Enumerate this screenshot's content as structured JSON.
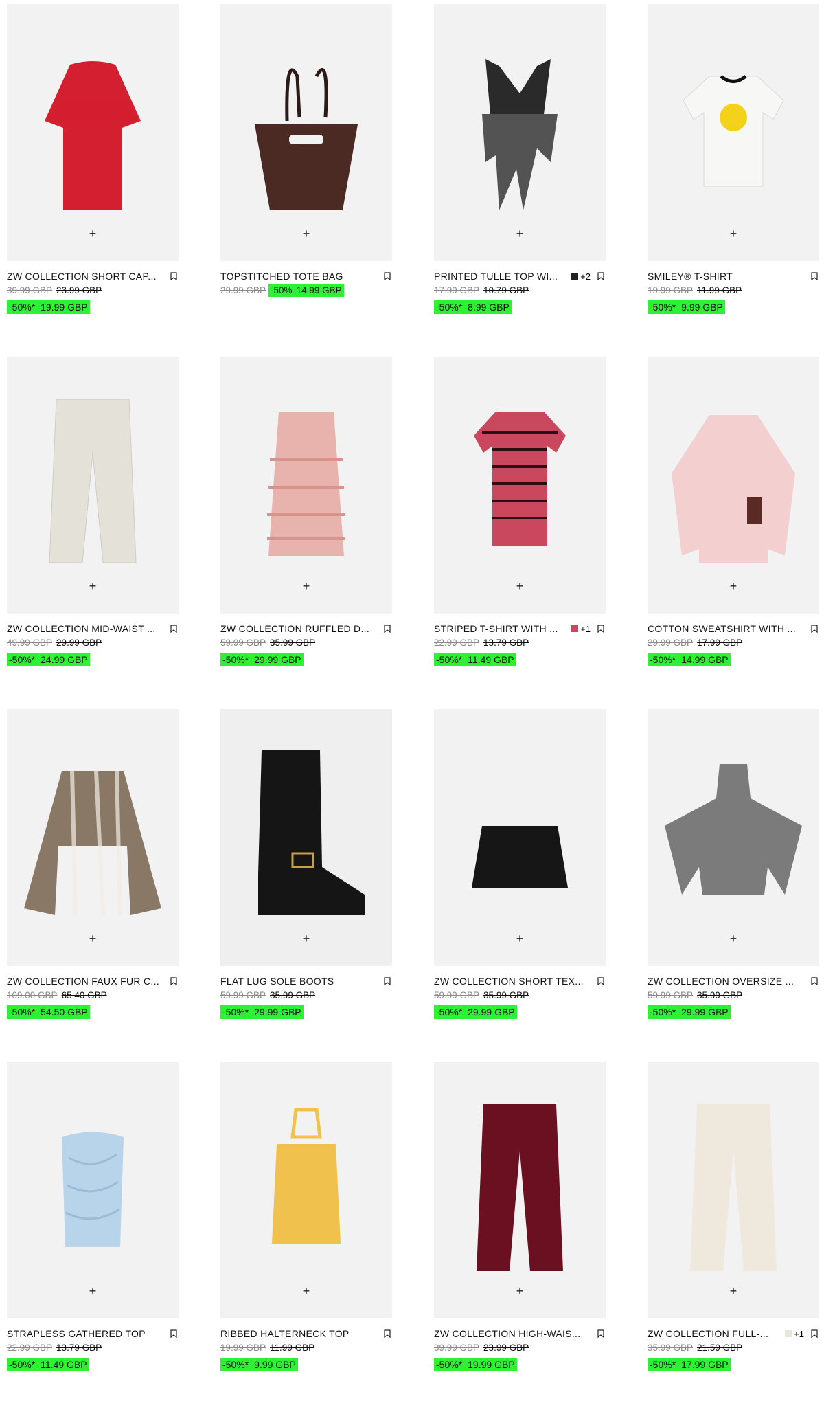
{
  "colors": {
    "sale_highlight": "#2df233",
    "card_bg": "#f2f2f2",
    "old_price": "#8a8a8a"
  },
  "icons": {
    "add": "plus-icon",
    "save": "bookmark-icon"
  },
  "products": [
    {
      "name": "ZW COLLECTION SHORT CAP...",
      "old_price": "39.99 GBP",
      "mid_price": "23.99 GBP",
      "discount": "-50%*",
      "sale_price": "19.99 GBP",
      "art": "dress",
      "color": "#d31f2f"
    },
    {
      "name": "TOPSTITCHED TOTE BAG",
      "old_price": "29.99 GBP",
      "discount": "-50%",
      "sale_price": "14.99 GBP",
      "inline_sale": true,
      "art": "bag",
      "color": "#4a2a22"
    },
    {
      "name": "PRINTED TULLE TOP WI...",
      "old_price": "17.99 GBP",
      "mid_price": "10.79 GBP",
      "discount": "-50%*",
      "sale_price": "8.99 GBP",
      "swatch": "#222222",
      "more": "+2",
      "art": "tulle",
      "color": "#2a2a2a"
    },
    {
      "name": "SMILEY® T-SHIRT",
      "old_price": "19.99 GBP",
      "mid_price": "11.99 GBP",
      "discount": "-50%*",
      "sale_price": "9.99 GBP",
      "art": "tshirt",
      "color": "#f7f7f5"
    },
    {
      "name": "ZW COLLECTION MID-WAIST ...",
      "old_price": "49.99 GBP",
      "mid_price": "29.99 GBP",
      "discount": "-50%*",
      "sale_price": "24.99 GBP",
      "art": "jeans",
      "color": "#e3e1d8"
    },
    {
      "name": "ZW COLLECTION RUFFLED D...",
      "old_price": "59.99 GBP",
      "mid_price": "35.99 GBP",
      "discount": "-50%*",
      "sale_price": "29.99 GBP",
      "art": "ruffle",
      "color": "#e9b3ad"
    },
    {
      "name": "STRIPED T-SHIRT WITH ...",
      "old_price": "22.99 GBP",
      "mid_price": "13.79 GBP",
      "discount": "-50%*",
      "sale_price": "11.49 GBP",
      "swatch": "#c9485e",
      "more": "+1",
      "art": "stripe",
      "color": "#c9485e"
    },
    {
      "name": "COTTON SWEATSHIRT WITH ...",
      "old_price": "29.99 GBP",
      "mid_price": "17.99 GBP",
      "discount": "-50%*",
      "sale_price": "14.99 GBP",
      "art": "sweat",
      "color": "#f3cfd0"
    },
    {
      "name": "ZW COLLECTION FAUX FUR C...",
      "old_price": "109.00 GBP",
      "mid_price": "65.40 GBP",
      "discount": "-50%*",
      "sale_price": "54.50 GBP",
      "art": "fur",
      "color": "#8a7866"
    },
    {
      "name": "FLAT LUG SOLE BOOTS",
      "old_price": "59.99 GBP",
      "mid_price": "35.99 GBP",
      "discount": "-50%*",
      "sale_price": "29.99 GBP",
      "art": "boot",
      "color": "#151515",
      "bg": "#efefef"
    },
    {
      "name": "ZW COLLECTION SHORT TEX...",
      "old_price": "59.99 GBP",
      "mid_price": "35.99 GBP",
      "discount": "-50%*",
      "sale_price": "29.99 GBP",
      "art": "skirt",
      "color": "#161616"
    },
    {
      "name": "ZW COLLECTION OVERSIZE ...",
      "old_price": "59.99 GBP",
      "mid_price": "35.99 GBP",
      "discount": "-50%*",
      "sale_price": "29.99 GBP",
      "art": "poncho",
      "color": "#7b7b7b"
    },
    {
      "name": "STRAPLESS GATHERED TOP",
      "old_price": "22.99 GBP",
      "mid_price": "13.79 GBP",
      "discount": "-50%*",
      "sale_price": "11.49 GBP",
      "art": "tube",
      "color": "#b8d4ea"
    },
    {
      "name": "RIBBED HALTERNECK TOP",
      "old_price": "19.99 GBP",
      "mid_price": "11.99 GBP",
      "discount": "-50%*",
      "sale_price": "9.99 GBP",
      "art": "halter",
      "color": "#f0c24d"
    },
    {
      "name": "ZW COLLECTION HIGH-WAIS...",
      "old_price": "39.99 GBP",
      "mid_price": "23.99 GBP",
      "discount": "-50%*",
      "sale_price": "19.99 GBP",
      "art": "trousers",
      "color": "#6b1020"
    },
    {
      "name": "ZW COLLECTION FULL-...",
      "old_price": "35.99 GBP",
      "mid_price": "21.59 GBP",
      "discount": "-50%*",
      "sale_price": "17.99 GBP",
      "swatch": "#ece6d8",
      "more": "+1",
      "art": "trousers",
      "color": "#eee9dc"
    }
  ]
}
